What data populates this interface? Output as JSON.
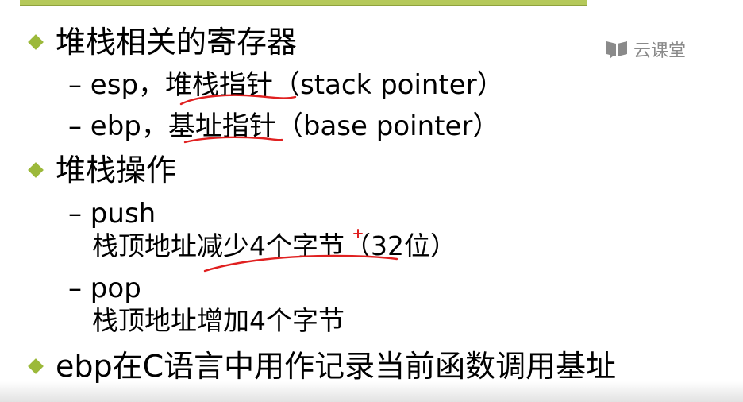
{
  "watermark": {
    "icon": "book-chat-icon",
    "text": "云课堂"
  },
  "bullets": {
    "b1": "堆栈相关的寄存器",
    "b2": "堆栈操作",
    "b3": "ebp在C语言中用作记录当前函数调用基址"
  },
  "subs": {
    "esp": "– esp，堆栈指针（stack pointer）",
    "ebp": "– ebp，基址指针（base pointer）",
    "push": "– push",
    "push_desc": "栈顶地址减少4个字节（32位）",
    "pop": "– pop",
    "pop_desc": "栈顶地址增加4个字节"
  },
  "colors": {
    "bullet": "#9cb93a",
    "annotation": "#e02020",
    "rule": "#b5c95a"
  }
}
